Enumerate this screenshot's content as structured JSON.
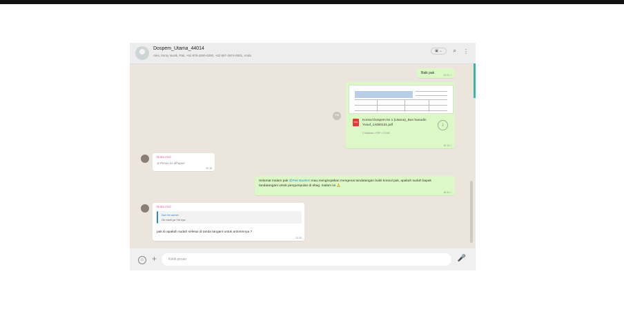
{
  "header": {
    "group_name": "Dospem_Utama_44014",
    "members": "Alex, Imroy Nusik, Pak, +62 878-2000-0290, +62 857-2874-0001, Anda"
  },
  "messages": {
    "m1": {
      "text": "Baik pak",
      "time": "10.11 ✓"
    },
    "m2": {
      "doc_name": "Konsul Dospem ke 1 (Utama)_Bun hanudin Yusuf_14490131.pdf",
      "meta": "3 halaman • PDF • 3,9 kB",
      "time": "10.14 ✓"
    },
    "m3": {
      "sender": "Nuria Ansl",
      "text": "Pesan ini dihapus",
      "time": "10.16"
    },
    "m4": {
      "pre": "Selamat malam pak ",
      "mention": "@Pak Baahim",
      "post": " mau menginqatkan mengenai tandatangan bukti konsul pak, apakah sudah bapak tandatangani untuk pengumpulan di eltag. malam ini 🙏",
      "time": "18.31 ✓"
    },
    "m5": {
      "sender": "Nuria Ansl",
      "quote_author": "Nuri Ila admin",
      "quote_text": "Ok nanti ya Yid nya",
      "text": "pak ib apakah sudah selesai di tanda tangani untuk antonmnya ?",
      "time": "21.00"
    }
  },
  "footer": {
    "placeholder": "Ketik pesan"
  },
  "icons": {
    "emoji": "☺",
    "plus": "+",
    "mic": "🎤",
    "search": "⌕",
    "menu": "⋮",
    "download": "⤓",
    "forward": "↪",
    "deleted": "⊘",
    "pdf": "PDF"
  }
}
